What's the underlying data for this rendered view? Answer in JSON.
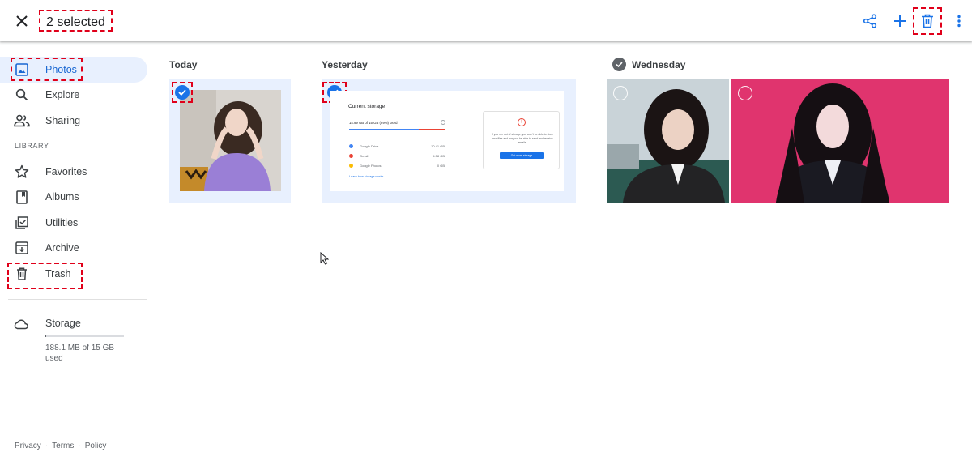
{
  "topbar": {
    "selected_label": "2 selected",
    "actions": [
      "share-icon",
      "add-icon",
      "trash-icon",
      "more-vert-icon"
    ]
  },
  "sidebar": {
    "items": [
      {
        "label": "Photos",
        "icon": "photo-icon",
        "active": true
      },
      {
        "label": "Explore",
        "icon": "search-icon"
      },
      {
        "label": "Sharing",
        "icon": "people-icon"
      }
    ],
    "library_label": "LIBRARY",
    "library_items": [
      {
        "label": "Favorites",
        "icon": "star-icon"
      },
      {
        "label": "Albums",
        "icon": "album-icon"
      },
      {
        "label": "Utilities",
        "icon": "utilities-icon"
      },
      {
        "label": "Archive",
        "icon": "archive-icon"
      },
      {
        "label": "Trash",
        "icon": "trash-icon"
      }
    ],
    "storage": {
      "label": "Storage",
      "used_text": "188.1 MB of 15 GB used",
      "fraction_used": 0.012
    }
  },
  "footer": {
    "privacy": "Privacy",
    "terms": "Terms",
    "policy": "Policy",
    "sep": "·"
  },
  "sections": [
    {
      "title": "Today",
      "photos": [
        {
          "selected": true
        }
      ]
    },
    {
      "title": "Yesterday",
      "photos": [
        {
          "selected": true
        }
      ]
    },
    {
      "title": "Wednesday",
      "photos": [
        {
          "selected": false
        },
        {
          "selected": false
        }
      ]
    }
  ],
  "storage_screenshot": {
    "title": "Current storage",
    "used": "14.99 GB of 15 GB (99%) used",
    "rows": [
      {
        "name": "Google Drive",
        "value": "10.41 GB",
        "color": "#4285f4"
      },
      {
        "name": "Gmail",
        "value": "4.58 GB",
        "color": "#ea4335"
      },
      {
        "name": "Google Photos",
        "value": "0 GB",
        "color": "#fbbc04"
      }
    ],
    "link": "Learn how storage works",
    "card_message": "If you run out of storage, you won't be able to store new files and may not be able to send and receive emails.",
    "card_button": "Get more storage"
  },
  "colors": {
    "accent": "#1a73e8",
    "highlight": "#e0001a",
    "selected_bg": "#e8f0fe"
  }
}
